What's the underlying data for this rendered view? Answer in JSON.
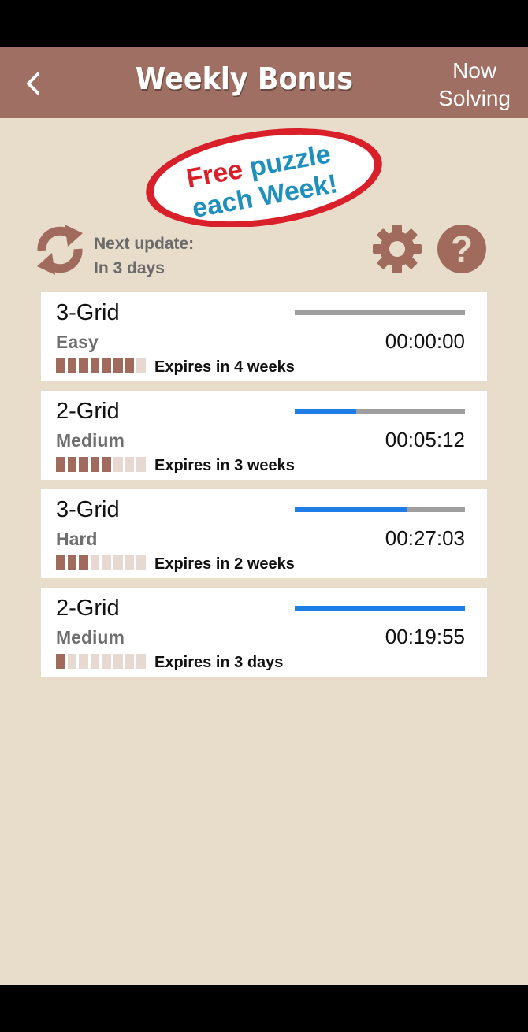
{
  "header": {
    "title": "Weekly Bonus",
    "now_solving_line1": "Now",
    "now_solving_line2": "Solving"
  },
  "promo": {
    "line1": "Free puzzle",
    "line2": "each Week!"
  },
  "update": {
    "label": "Next update:",
    "value": "In 3 days"
  },
  "colors": {
    "nav": "#9e6f62",
    "background": "#e8dccb",
    "progress_fill": "#1f7de6",
    "progress_track": "#9e9e9e",
    "expiry_on": "#a06a5c",
    "expiry_off": "#e8d8d2"
  },
  "puzzles": [
    {
      "title": "3-Grid",
      "difficulty": "Easy",
      "time": "00:00:00",
      "progress": 0.0,
      "expiry_filled": 7,
      "expiry_total": 8,
      "expires": "Expires in 4 weeks"
    },
    {
      "title": "2-Grid",
      "difficulty": "Medium",
      "time": "00:05:12",
      "progress": 0.36,
      "expiry_filled": 5,
      "expiry_total": 8,
      "expires": "Expires in 3 weeks"
    },
    {
      "title": "3-Grid",
      "difficulty": "Hard",
      "time": "00:27:03",
      "progress": 0.66,
      "expiry_filled": 3,
      "expiry_total": 8,
      "expires": "Expires in 2 weeks"
    },
    {
      "title": "2-Grid",
      "difficulty": "Medium",
      "time": "00:19:55",
      "progress": 1.0,
      "expiry_filled": 1,
      "expiry_total": 8,
      "expires": "Expires in 3 days"
    }
  ]
}
